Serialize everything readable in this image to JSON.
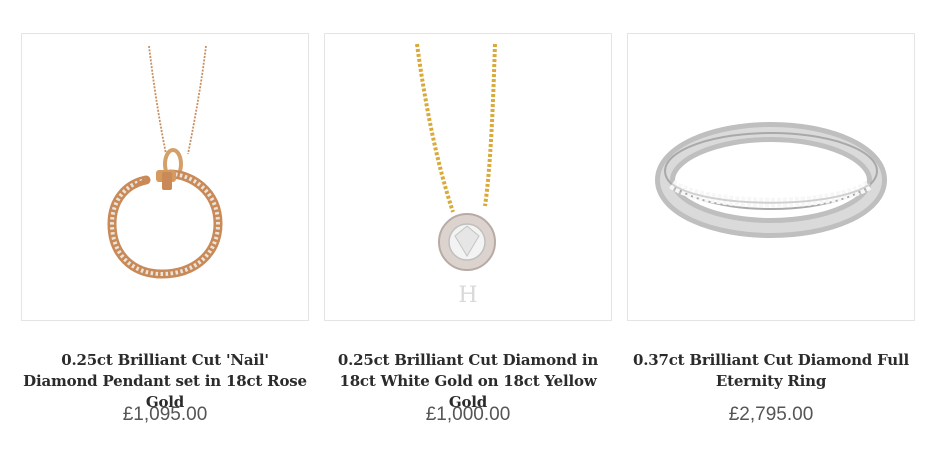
{
  "products": [
    {
      "title": "0.25ct Brilliant Cut 'Nail' Diamond Pendant set in 18ct Rose Gold",
      "price": "£1,095.00",
      "icon": "rose-gold-nail-pendant"
    },
    {
      "title": "0.25ct Brilliant Cut Diamond in 18ct White Gold on 18ct Yellow Gold",
      "price": "£1,000.00",
      "icon": "solitaire-pendant"
    },
    {
      "title": "0.37ct Brilliant Cut Diamond Full Eternity Ring",
      "price": "£2,795.00",
      "icon": "eternity-ring"
    }
  ]
}
